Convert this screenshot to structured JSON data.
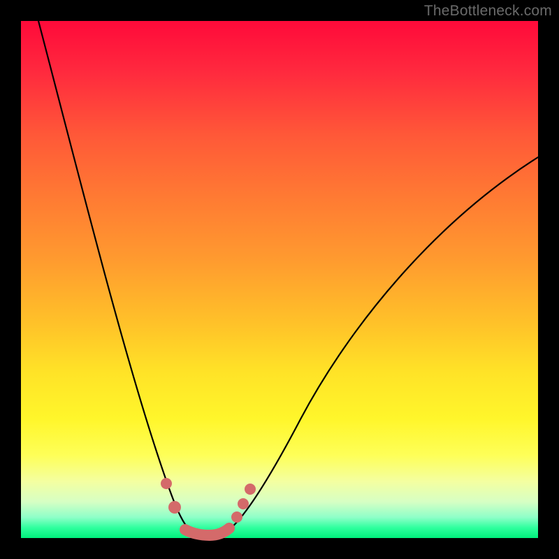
{
  "watermark": "TheBottleneck.com",
  "chart_data": {
    "type": "line",
    "title": "",
    "xlabel": "",
    "ylabel": "",
    "xlim": [
      0,
      100
    ],
    "ylim": [
      0,
      100
    ],
    "grid": false,
    "series": [
      {
        "name": "bottleneck-curve",
        "x": [
          0,
          5,
          10,
          15,
          20,
          25,
          28,
          30,
          32,
          34,
          36,
          38,
          40,
          45,
          50,
          55,
          60,
          65,
          70,
          75,
          80,
          85,
          90,
          95,
          100
        ],
        "y": [
          100,
          82,
          64,
          47,
          30,
          14,
          6,
          2,
          0,
          0,
          0,
          2,
          5,
          12,
          20,
          27,
          34,
          40,
          46,
          52,
          57,
          62,
          66,
          70,
          74
        ]
      }
    ],
    "markers": [
      {
        "x": 25,
        "y": 13
      },
      {
        "x": 27,
        "y": 7
      },
      {
        "x": 30,
        "y": 1
      },
      {
        "x": 33,
        "y": 0
      },
      {
        "x": 36,
        "y": 1
      },
      {
        "x": 38,
        "y": 4
      },
      {
        "x": 39.5,
        "y": 8
      },
      {
        "x": 41,
        "y": 12
      }
    ],
    "background_gradient": {
      "top": "#ff0a3a",
      "mid": "#ffe327",
      "bottom": "#00f07c"
    }
  }
}
